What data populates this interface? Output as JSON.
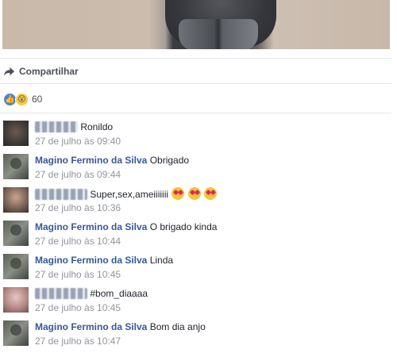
{
  "share": {
    "label": "Compartilhar",
    "icon": "share-arrow-icon"
  },
  "reactions": {
    "icons": [
      "like-icon",
      "wow-icon"
    ],
    "count": "60"
  },
  "comments": [
    {
      "author": "Ronildo",
      "author_masked": true,
      "text": "",
      "time": "27 de julho às 09:40"
    },
    {
      "author": "Magino Fermino da Silva",
      "author_masked": false,
      "text": "Obrigado",
      "time": "27 de julho às 09:44"
    },
    {
      "author": "",
      "author_masked": true,
      "text": "Super,sex,ameiiiiiii",
      "emoji_count": 3,
      "time": "27 de julho às 10:36"
    },
    {
      "author": "Magino Fermino da Silva",
      "author_masked": false,
      "text": "O brigado kinda",
      "time": "27 de julho às 10:44"
    },
    {
      "author": "Magino Fermino da Silva",
      "author_masked": false,
      "text": "Linda",
      "time": "27 de julho às 10:45"
    },
    {
      "author": "",
      "author_masked": true,
      "text": "#bom_diaaaa",
      "time": "27 de julho às 10:45"
    },
    {
      "author": "Magino Fermino da Silva",
      "author_masked": false,
      "text": "Bom dia anjo",
      "time": "27 de julho às 10:47"
    }
  ],
  "colors": {
    "author_link": "#365899",
    "timestamp": "#90949c",
    "like_blue": "#4f7fd8",
    "divider": "#e5e6e9"
  }
}
